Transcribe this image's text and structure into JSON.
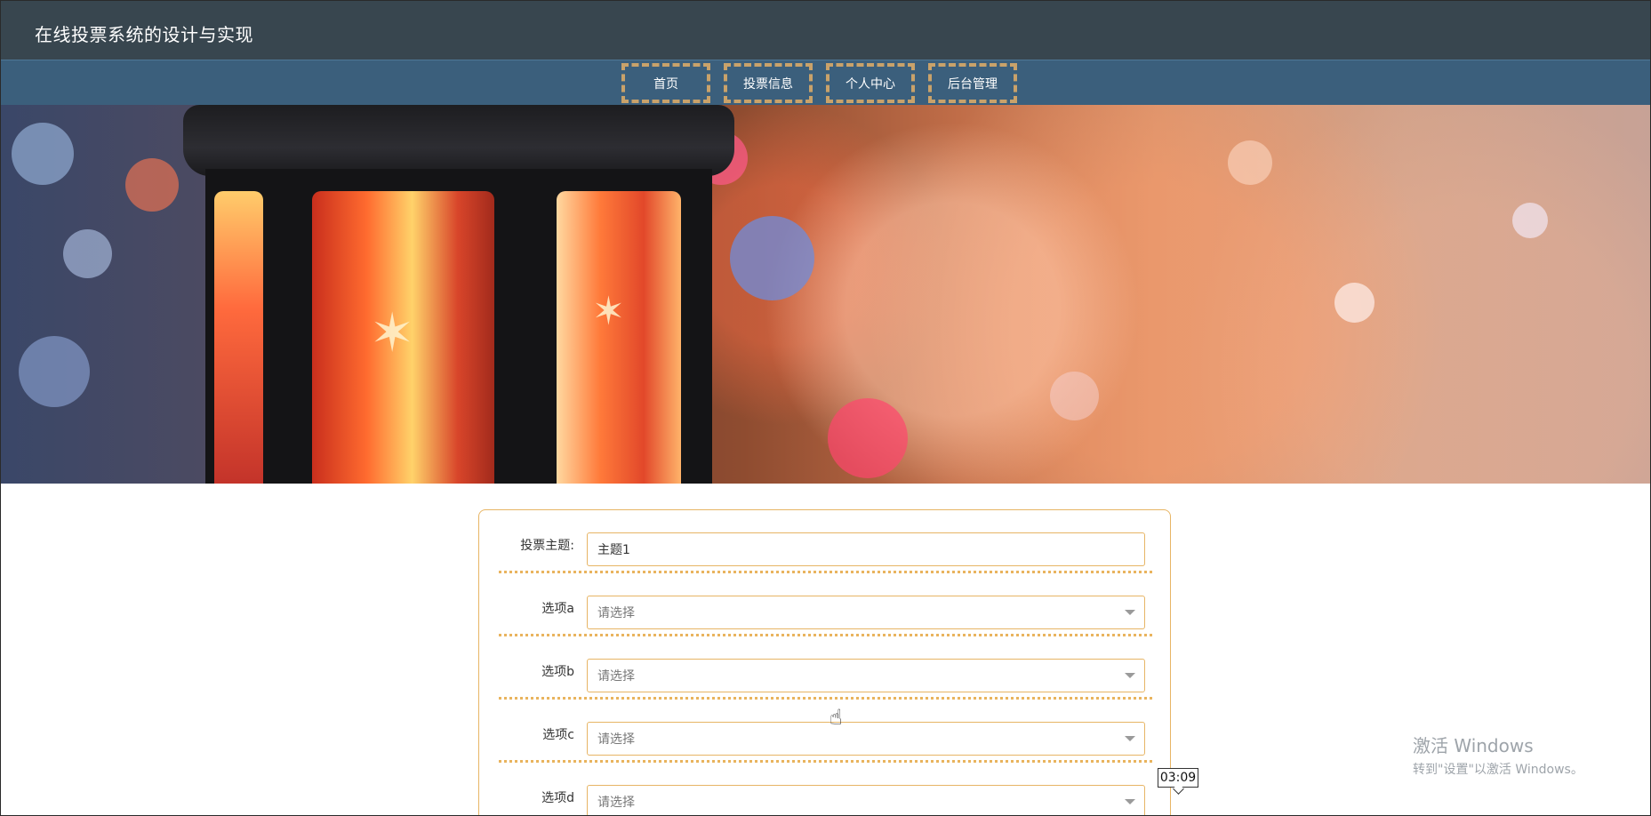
{
  "header": {
    "title": "在线投票系统的设计与实现"
  },
  "nav": {
    "items": [
      {
        "label": "首页"
      },
      {
        "label": "投票信息"
      },
      {
        "label": "个人中心"
      },
      {
        "label": "后台管理"
      }
    ]
  },
  "banner": {
    "slide_count": 3,
    "active_slide": 1
  },
  "form": {
    "topic_label": "投票主题:",
    "topic_value": "主题1",
    "options": [
      {
        "label": "选项a",
        "placeholder": "请选择"
      },
      {
        "label": "选项b",
        "placeholder": "请选择"
      },
      {
        "label": "选项c",
        "placeholder": "请选择"
      },
      {
        "label": "选项d",
        "placeholder": "请选择"
      }
    ]
  },
  "watermark": {
    "title": "激活 Windows",
    "subtitle": "转到\"设置\"以激活 Windows。"
  },
  "timer": {
    "value": "03:09"
  },
  "colors": {
    "topbar": "#38464f",
    "navbar": "#3b5f7c",
    "accent": "#c9a26a",
    "form_border": "#e7b565"
  }
}
